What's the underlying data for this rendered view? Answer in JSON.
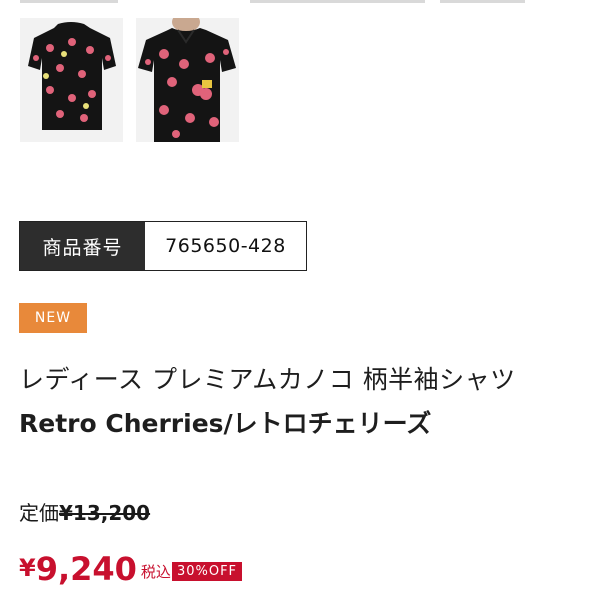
{
  "product_images": [
    {
      "alt": "shirt back view"
    },
    {
      "alt": "shirt front view"
    }
  ],
  "product_code": {
    "label": "商品番号",
    "value": "765650-428"
  },
  "badge_new": "NEW",
  "title": {
    "line1": "レディース プレミアムカノコ 柄半袖シャツ",
    "line2": "Retro Cherries/レトロチェリーズ"
  },
  "list_price": {
    "label": "定価",
    "value": "¥13,200"
  },
  "sale_price": {
    "yen": "¥",
    "amount": "9,240",
    "tax_label": "税込",
    "discount_badge": "30%OFF"
  },
  "colors": {
    "accent_red": "#c8102e",
    "new_badge": "#e8893a",
    "dark": "#2d2d2d"
  }
}
